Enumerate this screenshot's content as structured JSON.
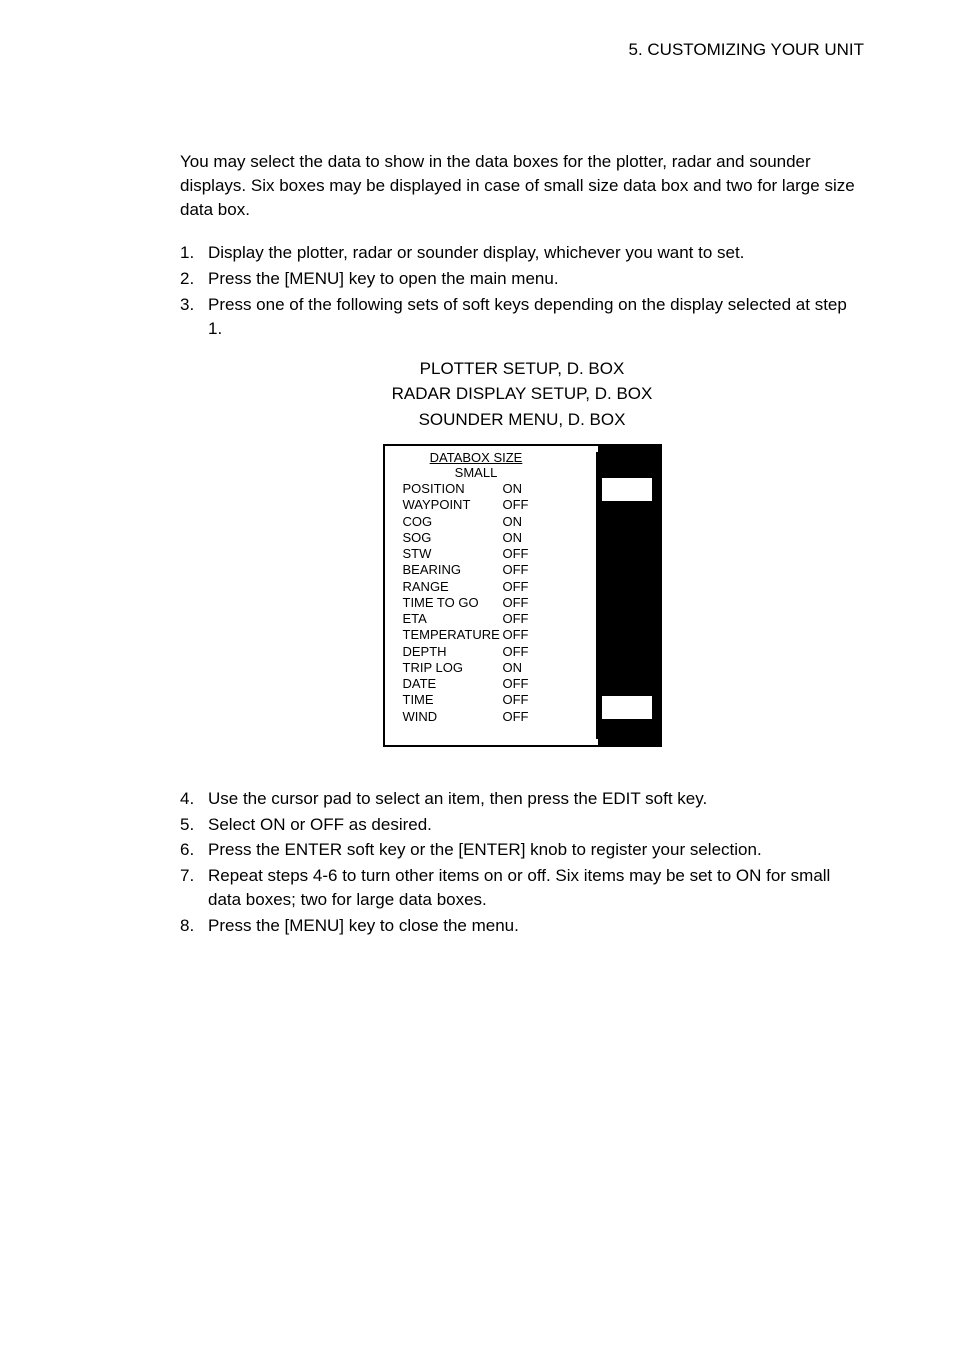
{
  "header": "5. CUSTOMIZING YOUR UNIT",
  "intro": "You may select the data to show in the data boxes for the plotter, radar and sounder displays. Six boxes may be displayed in case of small size data box and two for large size data box.",
  "steps1": [
    "Display the plotter, radar or sounder display, whichever you want to set.",
    "Press the [MENU] key to open the main menu.",
    "Press one of the following sets of soft keys depending on the display selected at step 1."
  ],
  "setup_lines": [
    "PLOTTER SETUP, D. BOX",
    "RADAR DISPLAY SETUP, D. BOX",
    "SOUNDER MENU, D. BOX"
  ],
  "databox": {
    "title": "DATABOX SIZE",
    "size": "SMALL",
    "items": [
      {
        "label": "POSITION",
        "value": "ON"
      },
      {
        "label": "WAYPOINT",
        "value": "OFF"
      },
      {
        "label": "COG",
        "value": "ON"
      },
      {
        "label": "SOG",
        "value": "ON"
      },
      {
        "label": "STW",
        "value": "OFF"
      },
      {
        "label": "BEARING",
        "value": "OFF"
      },
      {
        "label": "RANGE",
        "value": "OFF"
      },
      {
        "label": "TIME TO GO",
        "value": "OFF"
      },
      {
        "label": "ETA",
        "value": "OFF"
      },
      {
        "label": "TEMPERATURE",
        "value": "OFF"
      },
      {
        "label": "DEPTH",
        "value": "OFF"
      },
      {
        "label": "TRIP LOG",
        "value": "ON"
      },
      {
        "label": "DATE",
        "value": "OFF"
      },
      {
        "label": "TIME",
        "value": "OFF"
      },
      {
        "label": "WIND",
        "value": "OFF"
      }
    ]
  },
  "steps2": [
    {
      "n": "4.",
      "t": "Use the cursor pad to select an item, then press the EDIT soft key."
    },
    {
      "n": "5.",
      "t": "Select ON or OFF as desired."
    },
    {
      "n": "6.",
      "t": "Press the ENTER soft key or the [ENTER] knob to register your selection."
    },
    {
      "n": "7.",
      "t": "Repeat steps 4-6 to turn other items on or off. Six items may be set to ON for small data boxes; two for large data boxes."
    },
    {
      "n": "8.",
      "t": "Press the [MENU] key to close the menu."
    }
  ]
}
